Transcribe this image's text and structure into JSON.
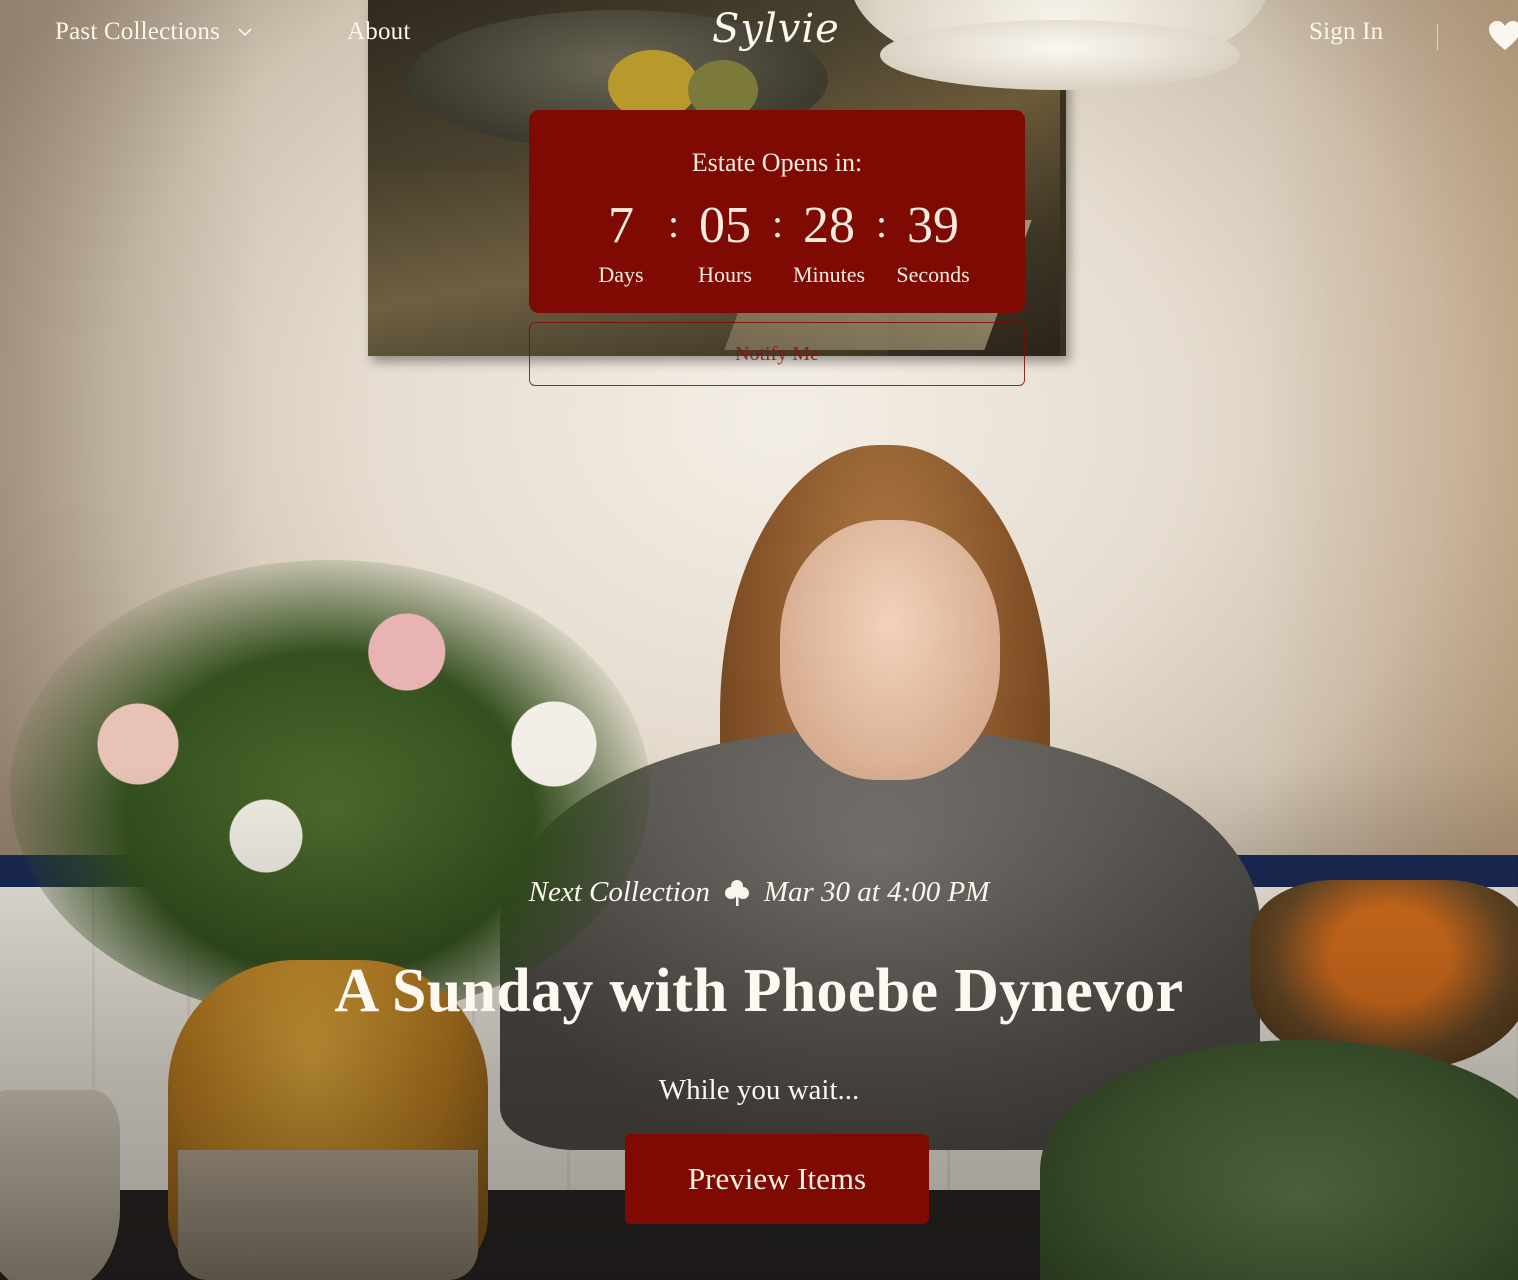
{
  "nav": {
    "past_collections": "Past Collections",
    "about": "About",
    "logo": "Sylvie",
    "sign_in": "Sign In"
  },
  "countdown": {
    "title": "Estate Opens in:",
    "days": "7",
    "days_label": "Days",
    "hours": "05",
    "hours_label": "Hours",
    "minutes": "28",
    "minutes_label": "Minutes",
    "seconds": "39",
    "seconds_label": "Seconds",
    "separator": ":",
    "notify_label": "Notify Me"
  },
  "hero": {
    "next_label": "Next Collection",
    "next_date": "Mar 30 at 4:00 PM",
    "headline": "A Sunday with Phoebe Dynevor",
    "wait_text": "While you wait...",
    "preview_button": "Preview Items"
  },
  "icons": {
    "dropdown": "chevron-down-icon",
    "favorites": "heart-icon",
    "separator": "clover-icon"
  },
  "colors": {
    "accent": "#7e0a03",
    "text_light": "#fbf6ee"
  }
}
